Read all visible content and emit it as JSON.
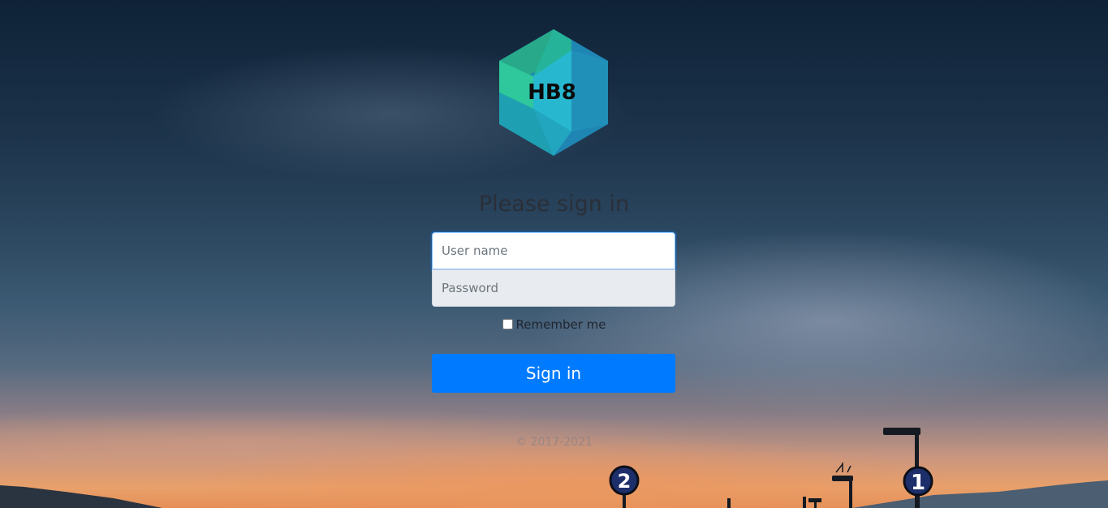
{
  "logo": {
    "text": "HB8",
    "colors": {
      "light_green": "#2fd3a0",
      "teal": "#1fa6b5",
      "cyan": "#27b4cc",
      "blue": "#1f86b4"
    }
  },
  "form": {
    "title": "Please sign in",
    "username_placeholder": "User name",
    "password_placeholder": "Password",
    "remember_label": "Remember me",
    "remember_checked": false,
    "submit_label": "Sign in"
  },
  "footer": {
    "copyright": "© 2017-2021"
  },
  "background": {
    "signs": {
      "left": "2",
      "right": "1"
    }
  },
  "colors": {
    "primary": "#007bff",
    "focus_border": "#80bdff"
  }
}
